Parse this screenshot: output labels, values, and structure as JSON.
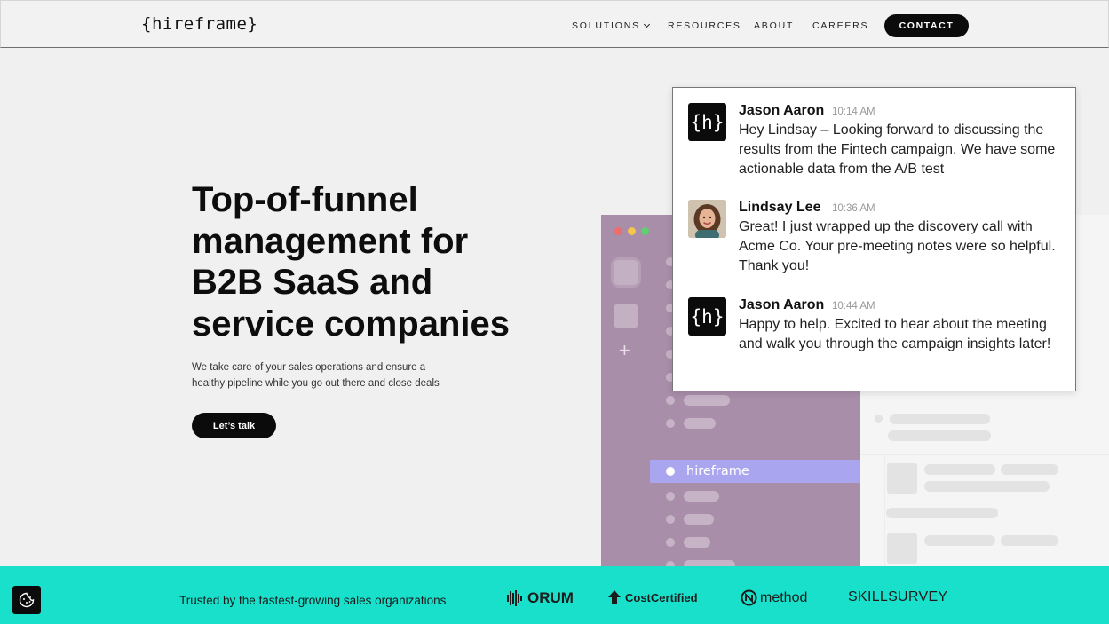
{
  "header": {
    "logo": "{hireframe}",
    "nav": [
      {
        "label": "SOLUTIONS",
        "has_dropdown": true
      },
      {
        "label": "RESOURCES"
      },
      {
        "label": "ABOUT"
      },
      {
        "label": "CAREERS"
      }
    ],
    "contact_label": "CONTACT"
  },
  "hero": {
    "title_bold_1": "Top-of-funnel",
    "title_bold_2": "management",
    "title_rest_1": " for",
    "title_rest_2": "B2B SaaS and",
    "title_rest_3": "service companies",
    "subtitle_1": "We take care of your sales operations and ensure a",
    "subtitle_2": "healthy pipeline while you go out there and close deals",
    "cta_label": "Let’s talk"
  },
  "app": {
    "active_channel": "hireframe"
  },
  "chat": {
    "messages": [
      {
        "name": "Jason Aaron",
        "time": "10:14 AM",
        "avatar": "{h}",
        "text": "Hey Lindsay – Looking forward to discussing the results from the Fintech campaign. We have some actionable data from the A/B test"
      },
      {
        "name": "Lindsay Lee",
        "time": "10:36 AM",
        "avatar": "photo",
        "text": "Great! I just wrapped up the discovery call with Acme Co. Your pre-meeting notes were so helpful. Thank you!"
      },
      {
        "name": "Jason Aaron",
        "time": "10:44 AM",
        "avatar": "{h}",
        "text": "Happy to help. Excited to hear about the meeting and walk you through the campaign insights later!"
      }
    ]
  },
  "trusted": {
    "text": "Trusted by the fastest-growing sales organizations",
    "brands": [
      "ORUM",
      "CostCertified",
      "method",
      "SKILLSURVEY"
    ]
  },
  "colors": {
    "band": "#19e0cb",
    "app_purple": "#a98ea9",
    "active_channel": "#a9a5ee",
    "button": "#0b0b0b"
  },
  "icons": {
    "cookie": "cookie-icon",
    "dropdown": "chevron-down-icon",
    "add": "plus-icon"
  }
}
